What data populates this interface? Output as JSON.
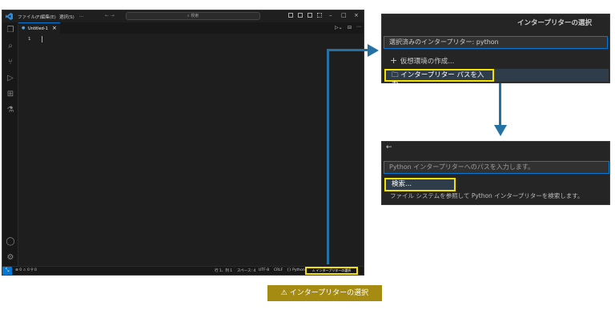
{
  "vscode": {
    "menu": [
      "ファイル(F)",
      "編集(E)",
      "選択(S)",
      "..."
    ],
    "nav_arrows": "← →",
    "search_placeholder": "検索",
    "tab_label": "Untitled-1",
    "tab_close": "×",
    "line_number": "1",
    "status_left": "⊗ 0 ⚠ 0   ⚲ 0",
    "status_items": [
      "行 1、列 1",
      "スペース: 4",
      "UTF-8",
      "CRLF",
      "{} Python"
    ],
    "status_interpreter": "⚠ インタープリターの選択"
  },
  "panel1": {
    "title": "インタープリターの選択",
    "input_placeholder": "選択済みのインタープリター: python",
    "option_create_venv": "仮想環境の作成...",
    "option_enter_path": "インタープリター パスを入力..."
  },
  "panel2": {
    "back_icon": "←",
    "input_placeholder": "Python インタープリターへのパスを入力します。",
    "option_search": "検索...",
    "option_search_desc": "ファイル システムを参照して Python インタープリターを検索します。"
  },
  "callout": {
    "label": "⚠ インタープリターの選択"
  },
  "colors": {
    "highlight": "#f5e100",
    "arrow": "#2472a4",
    "callout_bg": "#a58b12",
    "accent": "#0078d4"
  }
}
